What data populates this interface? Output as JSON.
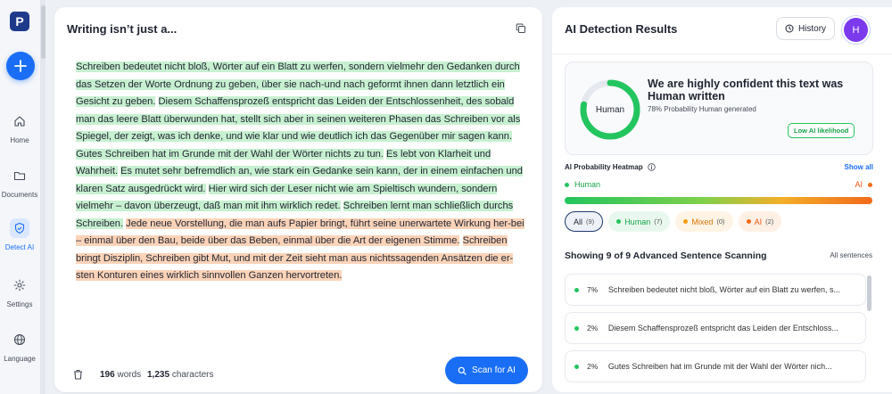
{
  "app": {
    "logo": "P",
    "colors": {
      "accent": "#1a6ef5",
      "human": "#22c55e",
      "mixed": "#f59e0b",
      "ai": "#f26a1b"
    }
  },
  "sidebar": {
    "new_icon": "plus-icon",
    "items": [
      {
        "label": "Home",
        "icon": "home-icon"
      },
      {
        "label": "Documents",
        "icon": "folder-icon"
      },
      {
        "label": "Detect AI",
        "icon": "shield-icon",
        "active": true
      },
      {
        "label": "Settings",
        "icon": "gear-icon"
      },
      {
        "label": "Language",
        "icon": "globe-icon"
      }
    ]
  },
  "editor": {
    "title": "Writing isn’t just a...",
    "segments": [
      {
        "text": "Schreiben bedeutet nicht bloß, Wörter auf ein Blatt zu werfen, sondern vielmehr den Gedanken durch das Setzen der Worte Ordnung zu geben, über sie nach-und nach geformt ihnen dann letztlich ein Gesicht zu geben.",
        "kind": "human"
      },
      {
        "text": "Diesem Schaffensprozeß entspricht das Leiden der Entschlossenheit, des sobald man das leere Blatt überwunden hat, stellt sich aber in seinen weiteren Phasen das Schreiben vor als Spiegel, der zeigt, was ich denke, und wie klar und wie deutlich ich das Gegenüber mir sagen kann.",
        "kind": "human"
      },
      {
        "text": "Gutes Schreiben hat im Grunde mit der Wahl der Wörter nichts zu tun.",
        "kind": "human"
      },
      {
        "text": "Es lebt von Klarheit und Wahrheit.",
        "kind": "human"
      },
      {
        "text": "Es mutet sehr befremdlich an, wie stark ein Gedanke sein kann, der in einem einfachen und klaren Satz ausgedrückt wird.",
        "kind": "human"
      },
      {
        "text": "Hier wird sich der Leser nicht wie am Spieltisch wundern, sondern vielmehr – davon überzeugt, daß man mit ihm wirklich redet.",
        "kind": "human"
      },
      {
        "text": "Schreiben lernt man schließlich durchs Schreiben.",
        "kind": "human"
      },
      {
        "text": "Jede neue Vorstellung, die man aufs Papier bringt, führt seine unerwartete Wirkung her-bei – einmal über den Bau, beide über das Beben, einmal über die Art der eigenen Stimme.",
        "kind": "mixed"
      },
      {
        "text": "Schreiben bringt Disziplin, Schreiben gibt Mut, und mit der Zeit sieht man aus nichtssagenden Ansätzen die er-sten Konturen eines wirklich sinnvollen Ganzen hervortreten.",
        "kind": "mixed"
      }
    ],
    "word_count": "196",
    "word_label": "words",
    "char_count": "1,235",
    "char_label": "characters",
    "scan_label": "Scan for AI"
  },
  "results": {
    "title": "AI Detection Results",
    "history_label": "History",
    "avatar_letter": "H",
    "verdict": {
      "donut_label": "Human",
      "human_fraction": 0.78,
      "headline": "We are highly confident this text was Human written",
      "sub": "78% Probability Human generated",
      "badge": "Low AI likelihood"
    },
    "heatmap": {
      "title": "AI Probability Heatmap",
      "show_all": "Show all",
      "left": "Human",
      "right": "AI"
    },
    "filters": [
      {
        "label": "All",
        "count": "(9)"
      },
      {
        "label": "Human",
        "count": "(7)"
      },
      {
        "label": "Mixed",
        "count": "(0)"
      },
      {
        "label": "AI",
        "count": "(2)"
      }
    ],
    "scan_title": "Showing 9 of 9 Advanced Sentence Scanning",
    "all_sentences": "All sentences",
    "sentences": [
      {
        "pct": "7%",
        "text": "Schreiben bedeutet nicht bloß, Wörter auf ein Blatt zu werfen, s..."
      },
      {
        "pct": "2%",
        "text": "Diesem Schaffensprozeß entspricht das Leiden der Entschloss..."
      },
      {
        "pct": "2%",
        "text": "Gutes Schreiben hat im Grunde mit der Wahl der Wörter nich..."
      }
    ]
  }
}
